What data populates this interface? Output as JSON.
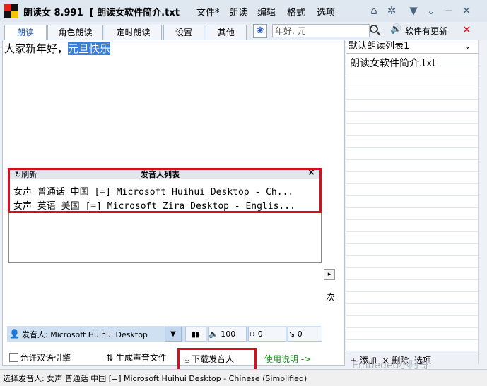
{
  "title": {
    "app": "朗读女 8.991",
    "doc": "[ 朗读女软件简介.txt",
    "menus": [
      "文件*",
      "朗读",
      "编辑",
      "格式",
      "选项"
    ]
  },
  "tabs": [
    "朗读",
    "角色朗读",
    "定时朗读",
    "设置",
    "其他"
  ],
  "search": {
    "value": "年好, 元"
  },
  "update_label": "软件有更新",
  "editor": {
    "text_plain": "大家新年好，",
    "text_selected": "元旦快乐"
  },
  "list": {
    "selected": "默认朗读列表1",
    "items": [
      "朗读女软件简介.txt"
    ]
  },
  "popup": {
    "refresh": "刷新",
    "title": "发音人列表",
    "close": "×",
    "rows": [
      "女声 普通话 中国 [=] Microsoft Huihui Desktop - Ch...",
      "女声 英语 美国 [=] Microsoft Zira Desktop - Englis..."
    ]
  },
  "side_char": "次",
  "voicebar": {
    "label": "发音人: Microsoft Huihui Desktop",
    "volume": "100",
    "speed": "0",
    "pitch": "0"
  },
  "bottom": {
    "allow_dual": "允许双语引擎",
    "generate": "生成声音文件",
    "download": "下载发音人",
    "help": "使用说明 ->",
    "list_tools": "+ 添加  × 删除  选项"
  },
  "watermark": "Embeded小阿哥",
  "status": "选择发音人: 女声 普通话 中国 [=] Microsoft Huihui Desktop - Chinese (Simplified)",
  "colors": {
    "highlight": "#3a7fd9",
    "red_box": "#d8101e",
    "help_green": "#1a8a1a"
  }
}
